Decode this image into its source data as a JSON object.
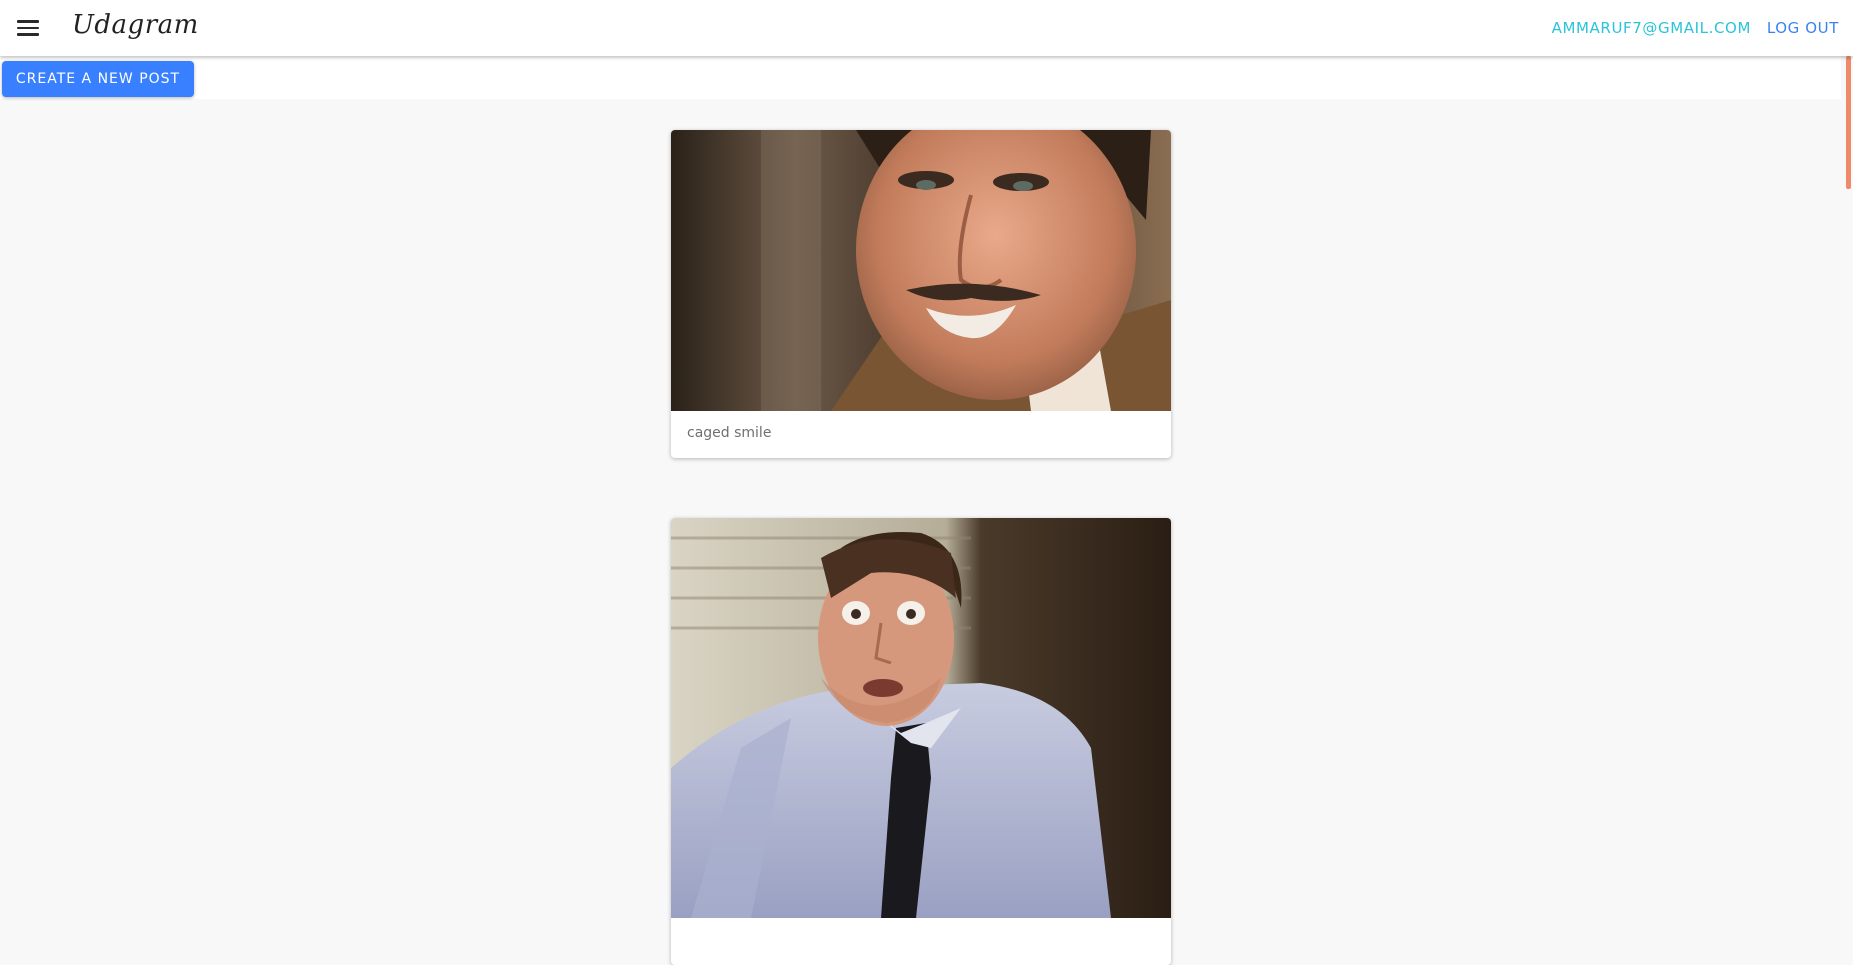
{
  "header": {
    "brand": "Udagram",
    "user_email": "AMMARUF7@GMAIL.COM",
    "logout_label": "LOG OUT"
  },
  "actions": {
    "create_post_label": "CREATE A NEW POST"
  },
  "feed": {
    "posts": [
      {
        "caption": "caged smile"
      },
      {
        "caption": ""
      }
    ]
  },
  "colors": {
    "accent": "#3880ff",
    "email": "#2bc3d8",
    "logout": "#3b82f0",
    "scrollbar": "#ee8a6a",
    "background": "#f8f8f8"
  },
  "icons": {
    "menu": "hamburger-menu-icon"
  }
}
